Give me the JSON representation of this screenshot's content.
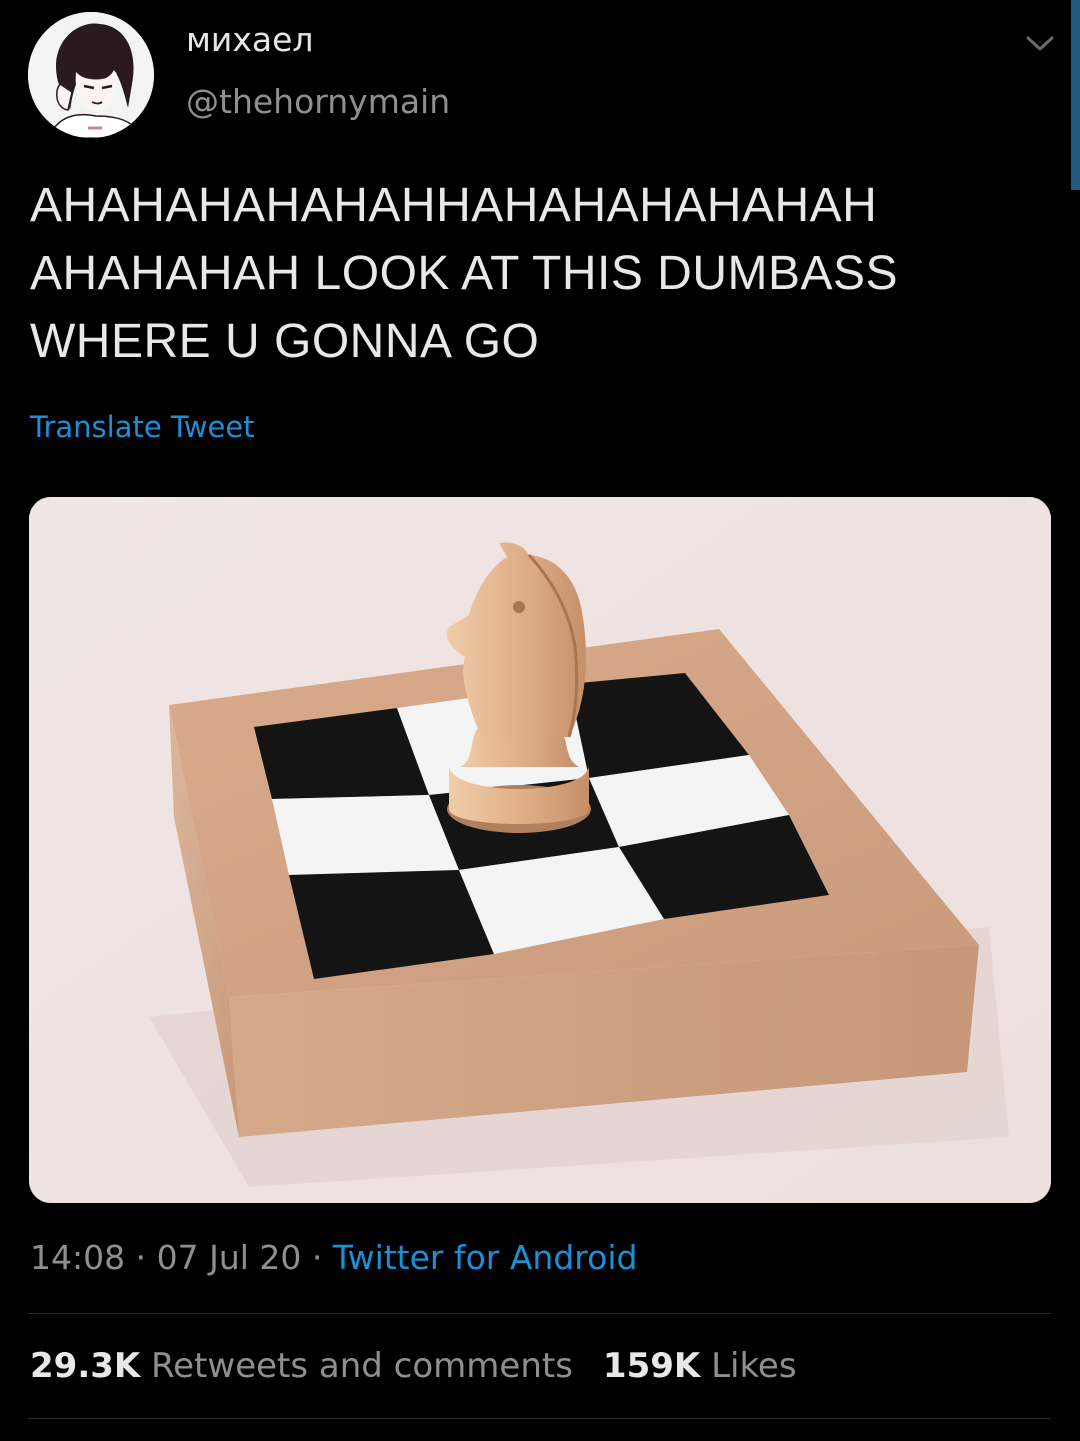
{
  "author": {
    "display_name": "михаел",
    "handle": "@thehornymain"
  },
  "tweet": {
    "lines": [
      "AHAHAHAHAHAHHAHAHAHAHAHAH",
      "AHAHAHAH LOOK AT THIS DUMBASS",
      "WHERE U GONNA GO"
    ],
    "translate_label": "Translate Tweet"
  },
  "meta": {
    "time": "14:08",
    "separator": "·",
    "date": "07 Jul 20",
    "source": "Twitter for Android"
  },
  "stats": {
    "retweets_count": "29.3K",
    "retweets_label": "Retweets and comments",
    "likes_count": "159K",
    "likes_label": "Likes"
  },
  "colors": {
    "background": "#000000",
    "link": "#1d8fd9",
    "secondary_text": "#8f8f8f"
  },
  "icons": {
    "menu": "chevron-down-icon"
  }
}
